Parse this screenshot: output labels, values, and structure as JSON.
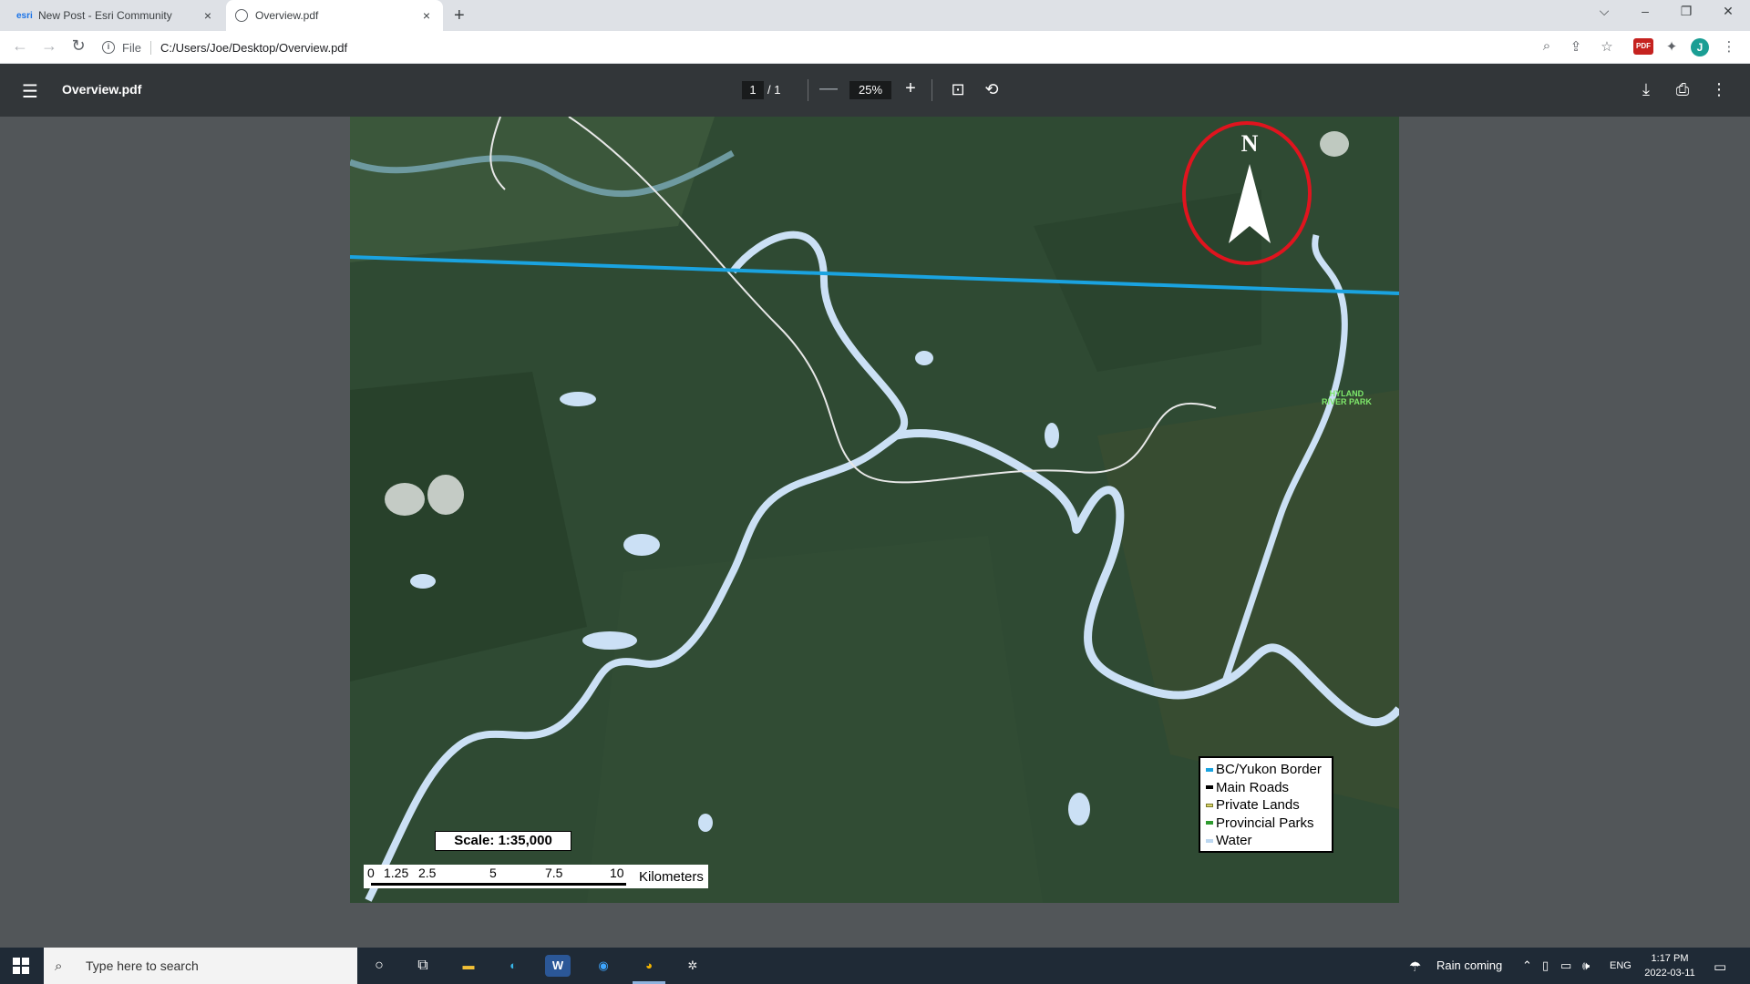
{
  "tabs": [
    {
      "favicon": "esri",
      "title": "New Post - Esri Community",
      "close": "×"
    },
    {
      "favicon": "globe-icon",
      "title": "Overview.pdf",
      "close": "×"
    }
  ],
  "new_tab": "+",
  "window_controls": {
    "dropdown": "⌵",
    "minimize": "–",
    "restore": "❐",
    "close": "✕"
  },
  "nav": {
    "back": "←",
    "forward": "→",
    "reload": "↻"
  },
  "omnibox": {
    "info": "i",
    "scheme": "File",
    "url": "C:/Users/Joe/Desktop/Overview.pdf"
  },
  "toolbar_icons": {
    "zoom": "⌕",
    "share": "⇪",
    "bookmark": "☆",
    "ext": "PDF",
    "puzzle": "✦",
    "profile": "J",
    "menu": "⋮"
  },
  "pdf": {
    "menu": "☰",
    "title": "Overview.pdf",
    "page_current": "1",
    "page_total": "/ 1",
    "zoom_out": "—",
    "zoom": "25%",
    "zoom_in": "+",
    "fit": "⊡",
    "rotate": "⟲",
    "download": "⤓",
    "print": "⎙",
    "more": "⋮"
  },
  "map": {
    "north_label": "N",
    "park_label_line1": "HYLAND",
    "park_label_line2": "RIVER PARK",
    "scale_label": "Scale: 1:35,000",
    "scale_ticks": [
      "0",
      "1.25",
      "2.5",
      "5",
      "7.5",
      "10"
    ],
    "scale_unit": "Kilometers",
    "legend": [
      {
        "label": "BC/Yukon Border",
        "color": "#1aa3e0"
      },
      {
        "label": "Main Roads",
        "color": "#000000"
      },
      {
        "label": "Private Lands",
        "color": "#d8d36a"
      },
      {
        "label": "Provincial Parks",
        "color": "#2e9a2e"
      },
      {
        "label": "Water",
        "color": "#bcd7f0"
      }
    ],
    "colors": {
      "border": "#1aa3e0",
      "water": "#cbe0f5",
      "road": "#e8e8e8",
      "highlight": "#e0141e"
    }
  },
  "taskbar": {
    "search_placeholder": "Type here to search",
    "weather": "Rain coming",
    "language": "ENG",
    "time": "1:17 PM",
    "date": "2022-03-11"
  }
}
